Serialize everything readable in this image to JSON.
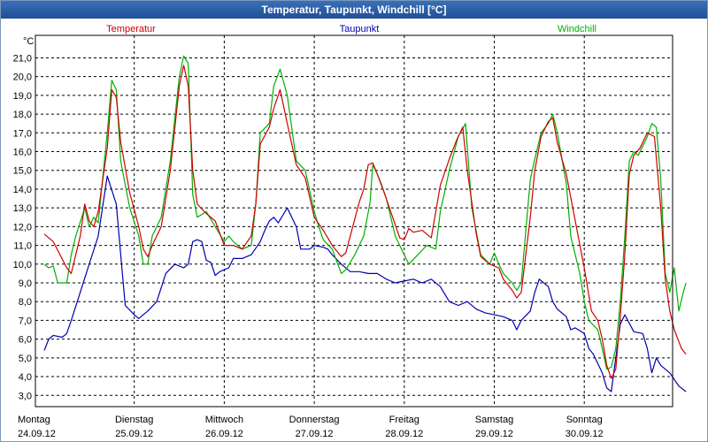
{
  "window": {
    "title": "Temperatur, Taupunkt, Windchill [°C]"
  },
  "colors": {
    "temperatur": "#d00000",
    "taupunkt": "#0000b0",
    "windchill": "#00b000",
    "grid": "#000000"
  },
  "chart_data": {
    "type": "line",
    "title": "Temperatur, Taupunkt, Windchill [°C]",
    "ylabel": "°C",
    "ylim": [
      2.4,
      22.2
    ],
    "y_ticks": [
      "3,0",
      "4,0",
      "5,0",
      "6,0",
      "7,0",
      "8,0",
      "9,0",
      "10,0",
      "11,0",
      "12,0",
      "13,0",
      "14,0",
      "15,0",
      "16,0",
      "17,0",
      "18,0",
      "19,0",
      "20,0",
      "21,0"
    ],
    "xlim": [
      0,
      7
    ],
    "x_day_labels": [
      {
        "day": "Montag",
        "date": "24.09.12"
      },
      {
        "day": "Dienstag",
        "date": "25.09.12"
      },
      {
        "day": "Mittwoch",
        "date": "26.09.12"
      },
      {
        "day": "Donnerstag",
        "date": "27.09.12"
      },
      {
        "day": "Freitag",
        "date": "28.09.12"
      },
      {
        "day": "Samstag",
        "date": "29.09.12"
      },
      {
        "day": "Sonntag",
        "date": "30.09.12"
      }
    ],
    "grid": true,
    "series": [
      {
        "name": "Temperatur",
        "color": "#d00000",
        "points": [
          [
            0,
            11.6
          ],
          [
            0.1,
            11.2
          ],
          [
            0.25,
            9.8
          ],
          [
            0.3,
            9.5
          ],
          [
            0.4,
            11.5
          ],
          [
            0.45,
            13.2
          ],
          [
            0.5,
            12.3
          ],
          [
            0.55,
            12.0
          ],
          [
            0.6,
            12.8
          ],
          [
            0.7,
            16.2
          ],
          [
            0.75,
            19.3
          ],
          [
            0.8,
            18.9
          ],
          [
            0.85,
            16.5
          ],
          [
            0.95,
            13.8
          ],
          [
            1.05,
            12.0
          ],
          [
            1.1,
            10.8
          ],
          [
            1.15,
            10.4
          ],
          [
            1.2,
            11.0
          ],
          [
            1.3,
            12.0
          ],
          [
            1.4,
            15.0
          ],
          [
            1.5,
            19.5
          ],
          [
            1.55,
            20.6
          ],
          [
            1.6,
            19.5
          ],
          [
            1.65,
            15.0
          ],
          [
            1.7,
            13.2
          ],
          [
            1.8,
            12.7
          ],
          [
            1.9,
            12.3
          ],
          [
            2.0,
            11.0
          ],
          [
            2.1,
            11.0
          ],
          [
            2.2,
            10.8
          ],
          [
            2.3,
            11.5
          ],
          [
            2.35,
            13.2
          ],
          [
            2.4,
            16.4
          ],
          [
            2.5,
            17.3
          ],
          [
            2.55,
            18.3
          ],
          [
            2.62,
            19.3
          ],
          [
            2.7,
            17.5
          ],
          [
            2.8,
            15.3
          ],
          [
            2.9,
            14.6
          ],
          [
            3.0,
            12.5
          ],
          [
            3.1,
            11.8
          ],
          [
            3.2,
            11.0
          ],
          [
            3.3,
            10.4
          ],
          [
            3.35,
            10.6
          ],
          [
            3.4,
            11.5
          ],
          [
            3.5,
            13.3
          ],
          [
            3.55,
            14.0
          ],
          [
            3.6,
            15.3
          ],
          [
            3.65,
            15.4
          ],
          [
            3.75,
            14.2
          ],
          [
            3.85,
            12.8
          ],
          [
            3.95,
            11.4
          ],
          [
            4.0,
            11.3
          ],
          [
            4.05,
            11.9
          ],
          [
            4.1,
            11.7
          ],
          [
            4.2,
            11.8
          ],
          [
            4.3,
            11.4
          ],
          [
            4.4,
            14.2
          ],
          [
            4.5,
            15.6
          ],
          [
            4.58,
            16.6
          ],
          [
            4.65,
            17.3
          ],
          [
            4.7,
            15.0
          ],
          [
            4.8,
            11.6
          ],
          [
            4.85,
            10.4
          ],
          [
            4.95,
            10.0
          ],
          [
            5.05,
            9.8
          ],
          [
            5.1,
            9.2
          ],
          [
            5.2,
            8.6
          ],
          [
            5.25,
            8.2
          ],
          [
            5.3,
            8.5
          ],
          [
            5.4,
            12.5
          ],
          [
            5.45,
            15.0
          ],
          [
            5.52,
            16.8
          ],
          [
            5.6,
            17.6
          ],
          [
            5.65,
            17.8
          ],
          [
            5.7,
            16.5
          ],
          [
            5.8,
            14.8
          ],
          [
            5.9,
            12.3
          ],
          [
            6.0,
            9.8
          ],
          [
            6.08,
            7.5
          ],
          [
            6.15,
            7.0
          ],
          [
            6.2,
            6.0
          ],
          [
            6.25,
            4.6
          ],
          [
            6.3,
            3.9
          ],
          [
            6.35,
            4.4
          ],
          [
            6.4,
            7.2
          ],
          [
            6.45,
            10.5
          ],
          [
            6.5,
            14.8
          ],
          [
            6.55,
            15.8
          ],
          [
            6.62,
            16.2
          ],
          [
            6.7,
            17.0
          ],
          [
            6.78,
            16.8
          ],
          [
            6.85,
            13.0
          ],
          [
            6.9,
            9.2
          ],
          [
            6.95,
            7.5
          ],
          [
            7.0,
            6.5
          ],
          [
            7.08,
            5.5
          ],
          [
            7.13,
            5.2
          ]
        ]
      },
      {
        "name": "Taupunkt",
        "color": "#0000b0",
        "points": [
          [
            0,
            5.4
          ],
          [
            0.05,
            6.0
          ],
          [
            0.1,
            6.2
          ],
          [
            0.2,
            6.1
          ],
          [
            0.25,
            6.3
          ],
          [
            0.3,
            7.0
          ],
          [
            0.4,
            8.5
          ],
          [
            0.5,
            10.0
          ],
          [
            0.6,
            11.5
          ],
          [
            0.7,
            14.7
          ],
          [
            0.8,
            13.2
          ],
          [
            0.85,
            10.5
          ],
          [
            0.9,
            7.8
          ],
          [
            1.0,
            7.3
          ],
          [
            1.05,
            7.1
          ],
          [
            1.15,
            7.5
          ],
          [
            1.25,
            8.0
          ],
          [
            1.35,
            9.5
          ],
          [
            1.45,
            10.0
          ],
          [
            1.55,
            9.8
          ],
          [
            1.6,
            10.0
          ],
          [
            1.65,
            11.2
          ],
          [
            1.7,
            11.3
          ],
          [
            1.75,
            11.2
          ],
          [
            1.8,
            10.2
          ],
          [
            1.85,
            10.1
          ],
          [
            1.9,
            9.4
          ],
          [
            1.95,
            9.6
          ],
          [
            2.05,
            9.8
          ],
          [
            2.1,
            10.3
          ],
          [
            2.2,
            10.3
          ],
          [
            2.3,
            10.5
          ],
          [
            2.4,
            11.2
          ],
          [
            2.45,
            11.8
          ],
          [
            2.5,
            12.3
          ],
          [
            2.55,
            12.5
          ],
          [
            2.6,
            12.2
          ],
          [
            2.7,
            13.0
          ],
          [
            2.8,
            12.0
          ],
          [
            2.85,
            10.8
          ],
          [
            2.95,
            10.8
          ],
          [
            3.0,
            11.0
          ],
          [
            3.1,
            10.9
          ],
          [
            3.15,
            10.8
          ],
          [
            3.2,
            10.5
          ],
          [
            3.3,
            10.0
          ],
          [
            3.4,
            9.6
          ],
          [
            3.5,
            9.6
          ],
          [
            3.6,
            9.5
          ],
          [
            3.7,
            9.5
          ],
          [
            3.8,
            9.2
          ],
          [
            3.9,
            9.0
          ],
          [
            4.0,
            9.1
          ],
          [
            4.1,
            9.2
          ],
          [
            4.2,
            9.0
          ],
          [
            4.3,
            9.2
          ],
          [
            4.4,
            8.8
          ],
          [
            4.5,
            8.0
          ],
          [
            4.6,
            7.8
          ],
          [
            4.7,
            8.0
          ],
          [
            4.8,
            7.6
          ],
          [
            4.9,
            7.4
          ],
          [
            5.0,
            7.3
          ],
          [
            5.1,
            7.2
          ],
          [
            5.2,
            7.0
          ],
          [
            5.25,
            6.5
          ],
          [
            5.3,
            7.0
          ],
          [
            5.4,
            7.5
          ],
          [
            5.45,
            8.5
          ],
          [
            5.5,
            9.2
          ],
          [
            5.6,
            8.8
          ],
          [
            5.65,
            8.0
          ],
          [
            5.7,
            7.6
          ],
          [
            5.8,
            7.2
          ],
          [
            5.85,
            6.5
          ],
          [
            5.9,
            6.6
          ],
          [
            6.0,
            6.3
          ],
          [
            6.05,
            5.5
          ],
          [
            6.1,
            5.2
          ],
          [
            6.2,
            4.2
          ],
          [
            6.25,
            3.4
          ],
          [
            6.3,
            3.2
          ],
          [
            6.35,
            5.0
          ],
          [
            6.4,
            6.8
          ],
          [
            6.45,
            7.3
          ],
          [
            6.55,
            6.4
          ],
          [
            6.65,
            6.3
          ],
          [
            6.7,
            5.5
          ],
          [
            6.75,
            4.2
          ],
          [
            6.8,
            5.0
          ],
          [
            6.85,
            4.6
          ],
          [
            6.95,
            4.2
          ],
          [
            7.05,
            3.5
          ],
          [
            7.13,
            3.2
          ]
        ]
      },
      {
        "name": "Windchill",
        "color": "#00b000",
        "points": [
          [
            0,
            10.0
          ],
          [
            0.05,
            9.8
          ],
          [
            0.1,
            9.9
          ],
          [
            0.15,
            9.0
          ],
          [
            0.25,
            9.0
          ],
          [
            0.3,
            10.5
          ],
          [
            0.35,
            11.5
          ],
          [
            0.45,
            13.0
          ],
          [
            0.5,
            12.0
          ],
          [
            0.55,
            12.5
          ],
          [
            0.6,
            12.2
          ],
          [
            0.7,
            17.0
          ],
          [
            0.75,
            19.8
          ],
          [
            0.8,
            19.3
          ],
          [
            0.85,
            15.5
          ],
          [
            0.95,
            13.0
          ],
          [
            1.05,
            11.5
          ],
          [
            1.1,
            10.0
          ],
          [
            1.15,
            10.0
          ],
          [
            1.2,
            11.5
          ],
          [
            1.3,
            12.5
          ],
          [
            1.4,
            15.5
          ],
          [
            1.5,
            20.0
          ],
          [
            1.55,
            21.1
          ],
          [
            1.6,
            20.7
          ],
          [
            1.65,
            13.7
          ],
          [
            1.7,
            12.5
          ],
          [
            1.8,
            12.8
          ],
          [
            1.9,
            12.0
          ],
          [
            2.0,
            11.2
          ],
          [
            2.05,
            11.5
          ],
          [
            2.1,
            11.2
          ],
          [
            2.2,
            10.8
          ],
          [
            2.3,
            11.0
          ],
          [
            2.35,
            13.2
          ],
          [
            2.4,
            17.0
          ],
          [
            2.5,
            17.5
          ],
          [
            2.55,
            19.5
          ],
          [
            2.62,
            20.4
          ],
          [
            2.7,
            19.0
          ],
          [
            2.8,
            15.5
          ],
          [
            2.9,
            15.0
          ],
          [
            3.0,
            12.8
          ],
          [
            3.05,
            12.0
          ],
          [
            3.1,
            11.3
          ],
          [
            3.2,
            10.8
          ],
          [
            3.3,
            9.5
          ],
          [
            3.35,
            9.7
          ],
          [
            3.45,
            10.5
          ],
          [
            3.55,
            11.5
          ],
          [
            3.62,
            13.3
          ],
          [
            3.65,
            15.3
          ],
          [
            3.7,
            14.8
          ],
          [
            3.8,
            13.5
          ],
          [
            3.9,
            11.5
          ],
          [
            4.0,
            10.5
          ],
          [
            4.05,
            10.0
          ],
          [
            4.15,
            10.5
          ],
          [
            4.25,
            11.0
          ],
          [
            4.35,
            10.8
          ],
          [
            4.4,
            12.8
          ],
          [
            4.5,
            15.0
          ],
          [
            4.6,
            16.8
          ],
          [
            4.68,
            17.5
          ],
          [
            4.75,
            13.0
          ],
          [
            4.85,
            10.5
          ],
          [
            4.95,
            10.0
          ],
          [
            5.0,
            10.6
          ],
          [
            5.05,
            10.0
          ],
          [
            5.1,
            9.5
          ],
          [
            5.2,
            9.0
          ],
          [
            5.25,
            8.6
          ],
          [
            5.3,
            9.0
          ],
          [
            5.4,
            14.5
          ],
          [
            5.45,
            15.6
          ],
          [
            5.52,
            17.0
          ],
          [
            5.6,
            17.5
          ],
          [
            5.65,
            18.0
          ],
          [
            5.7,
            17.0
          ],
          [
            5.8,
            14.3
          ],
          [
            5.85,
            11.5
          ],
          [
            5.95,
            9.5
          ],
          [
            6.0,
            8.0
          ],
          [
            6.05,
            7.0
          ],
          [
            6.15,
            6.5
          ],
          [
            6.2,
            5.5
          ],
          [
            6.25,
            4.4
          ],
          [
            6.3,
            4.5
          ],
          [
            6.35,
            5.5
          ],
          [
            6.4,
            8.0
          ],
          [
            6.45,
            11.5
          ],
          [
            6.5,
            15.5
          ],
          [
            6.55,
            16.0
          ],
          [
            6.6,
            15.8
          ],
          [
            6.7,
            16.8
          ],
          [
            6.75,
            17.5
          ],
          [
            6.8,
            17.3
          ],
          [
            6.85,
            14.5
          ],
          [
            6.9,
            9.5
          ],
          [
            6.95,
            8.5
          ],
          [
            7.0,
            9.8
          ],
          [
            7.05,
            7.5
          ],
          [
            7.1,
            8.5
          ],
          [
            7.13,
            9.0
          ]
        ]
      }
    ]
  }
}
